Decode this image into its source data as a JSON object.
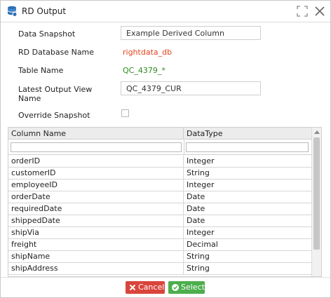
{
  "window": {
    "title": "RD Output",
    "icon": "database-icon",
    "controls": [
      "maximize-icon",
      "close-icon"
    ]
  },
  "form": {
    "data_snapshot_label": "Data Snapshot",
    "data_snapshot_value": "Example Derived Column",
    "rd_database_label": "RD Database Name",
    "rd_database_value": "rightdata_db",
    "table_name_label": "Table Name",
    "table_name_value": "QC_4379_*",
    "latest_output_view_label_line1": "Latest Output View",
    "latest_output_view_label_line2": "Name",
    "latest_output_view_value": "QC_4379_CUR",
    "override_snapshot_label": "Override Snapshot",
    "override_snapshot_checked": false
  },
  "colors": {
    "rd_database_value": "#e2431c",
    "table_name_value": "#2e8b22",
    "cancel_button": "#d9453b",
    "select_button": "#4cae4c"
  },
  "grid": {
    "columns": [
      "Column Name",
      "DataType"
    ],
    "filters": [
      "",
      ""
    ],
    "rows": [
      [
        "orderID",
        "Integer"
      ],
      [
        "customerID",
        "String"
      ],
      [
        "employeeID",
        "Integer"
      ],
      [
        "orderDate",
        "Date"
      ],
      [
        "requiredDate",
        "Date"
      ],
      [
        "shippedDate",
        "Date"
      ],
      [
        "shipVia",
        "Integer"
      ],
      [
        "freight",
        "Decimal"
      ],
      [
        "shipName",
        "String"
      ],
      [
        "shipAddress",
        "String"
      ]
    ]
  },
  "footer": {
    "cancel_label": "Cancel",
    "select_label": "Select"
  }
}
